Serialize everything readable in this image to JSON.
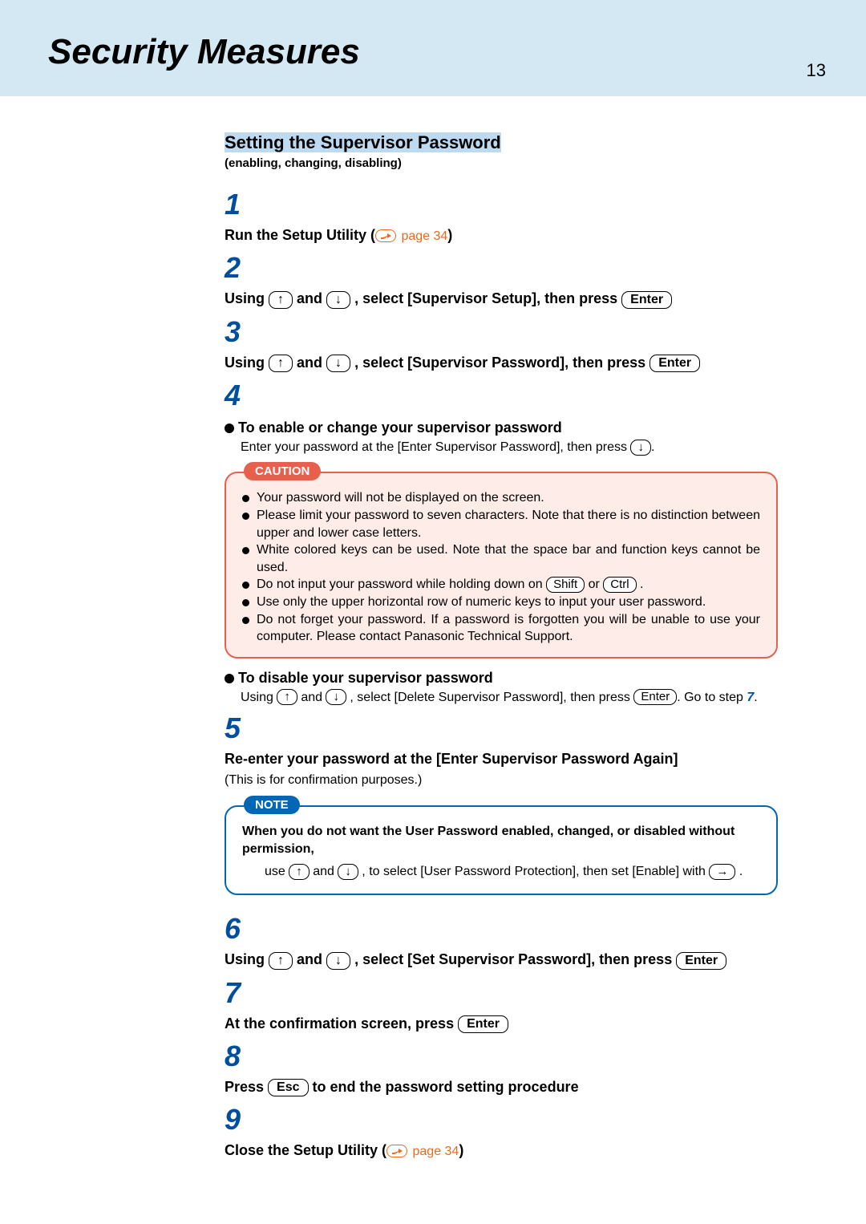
{
  "header": {
    "title": "Security Measures",
    "page_number": "13"
  },
  "section": {
    "title": "Setting the Supervisor Password",
    "subtitle": "(enabling, changing, disabling)"
  },
  "steps": {
    "s1_a": "Run the Setup Utility",
    "s1_ref": " page 34",
    "s2_a": "Using ",
    "s2_b": " and ",
    "s2_c": " , select [Supervisor Setup], then press ",
    "s3_a": "Using ",
    "s3_b": " and ",
    "s3_c": " , select [Supervisor Password], then press ",
    "s4_enable_heading": "To enable or change your supervisor password",
    "s4_enable_body": "Enter your password at the [Enter Supervisor Password], then press ",
    "s4_disable_heading": "To disable your supervisor password",
    "s4_disable_a": "Using ",
    "s4_disable_b": " and ",
    "s4_disable_c": ", select [Delete Supervisor Password], then press ",
    "s4_disable_d": ". Go to step ",
    "s4_disable_step": "7",
    "s4_disable_e": ".",
    "s5_heading": "Re-enter your password at the [Enter Supervisor Password Again]",
    "s5_body": "(This is for confirmation purposes.)",
    "s6_a": "Using ",
    "s6_b": " and ",
    "s6_c": " , select [Set Supervisor Password], then press ",
    "s7_a": "At the confirmation screen, press ",
    "s8_a": "Press ",
    "s8_b": " to end the password setting procedure",
    "s9_a": "Close the Setup Utility",
    "s9_ref": " page 34"
  },
  "caution": {
    "label": "CAUTION",
    "items": {
      "i1": "Your password will not be displayed on the screen.",
      "i2": "Please limit your password to seven characters.  Note that there is no distinction between upper and lower case letters.",
      "i3": "White colored keys can be used.  Note that the space bar and function keys cannot be used.",
      "i4a": "Do not input your password while holding down on ",
      "i4b": " or ",
      "i4c": " .",
      "i5": "Use only the upper horizontal row of numeric keys to input your user password.",
      "i6": "Do not forget your password.  If a password is forgotten you will be unable to use your computer.  Please contact Panasonic Technical Support."
    }
  },
  "note": {
    "label": "NOTE",
    "bold": "When you do not want the User Password enabled, changed, or disabled without permission,",
    "body_a": "use ",
    "body_b": " and ",
    "body_c": ", to select [User Password Protection], then set [Enable] with ",
    "body_d": "."
  },
  "keys": {
    "enter": "Enter",
    "shift": "Shift",
    "ctrl": "Ctrl",
    "esc": "Esc"
  }
}
